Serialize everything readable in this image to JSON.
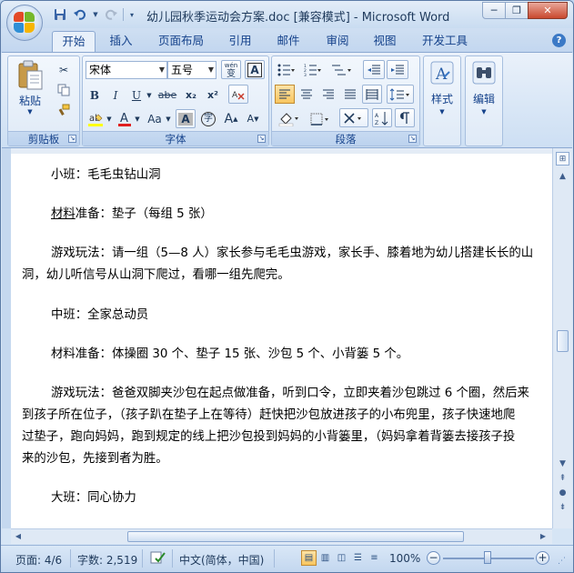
{
  "window": {
    "title": "幼儿园秋季运动会方案.doc [兼容模式] - Microsoft Word",
    "controls": {
      "minimize": "─",
      "restore": "❐",
      "close": "✕"
    }
  },
  "qat": {
    "save_icon": "save-icon",
    "undo_icon": "undo-icon",
    "redo_icon": "redo-icon"
  },
  "tabs": [
    "开始",
    "插入",
    "页面布局",
    "引用",
    "邮件",
    "审阅",
    "视图",
    "开发工具"
  ],
  "active_tab": "开始",
  "ribbon": {
    "clipboard": {
      "label": "剪贴板",
      "paste_label": "粘贴"
    },
    "font": {
      "label": "字体",
      "font_name": "宋体",
      "font_size": "五号",
      "bold": "B",
      "italic": "I",
      "underline": "U",
      "strike": "abe",
      "subscript": "x₂",
      "superscript": "x²",
      "case_label": "Aa",
      "char_border": "A",
      "grow": "A",
      "shrink": "A",
      "wen_label": "wén",
      "wen_char": "变",
      "char_shading": "A",
      "enclose_char": "字"
    },
    "paragraph": {
      "label": "段落"
    },
    "styles": {
      "label": "样式"
    },
    "editing": {
      "label": "编辑"
    }
  },
  "document": {
    "paragraphs": [
      "小班：毛毛虫钻山洞",
      "材料准备：垫子（每组 5 张）",
      "游戏玩法：请一组（5—8 人）家长参与毛毛虫游戏，家长手、膝着地为幼儿搭建长长的山",
      "洞，幼儿听信号从山洞下爬过，看哪一组先爬完。",
      "中班：全家总动员",
      "材料准备：体操圈 30 个、垫子 15 张、沙包 5 个、小背篓 5 个。",
      "游戏玩法：爸爸双脚夹沙包在起点做准备，听到口令，立即夹着沙包跳过 6 个圈，然后来",
      "到孩子所在位子，（孩子趴在垫子上在等待）赶快把沙包放进孩子的小布兜里，孩子快速地爬",
      "过垫子，跑向妈妈，跑到规定的线上把沙包投到妈妈的小背篓里，（妈妈拿着背篓去接孩子投",
      "来的沙包，先接到者为胜。",
      "大班：同心协力"
    ]
  },
  "statusbar": {
    "page": "页面: 4/6",
    "words": "字数: 2,519",
    "language": "中文(简体，中国)",
    "zoom": "100%",
    "zoom_level_percent": 100
  }
}
